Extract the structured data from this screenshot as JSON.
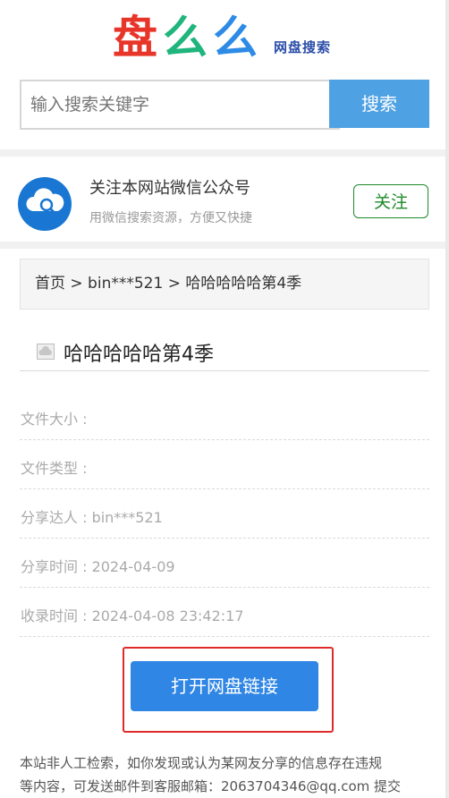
{
  "logo": {
    "char1": "盘",
    "char2": "么",
    "char3": "么",
    "subtitle": "网盘搜索"
  },
  "search": {
    "placeholder": "输入搜索关键字",
    "button_label": "搜索"
  },
  "follow": {
    "title": "关注本网站微信公众号",
    "subtitle": "用微信搜索资源，方便又快捷",
    "button_label": "关注"
  },
  "breadcrumb": {
    "text": "首页 > bin***521 > 哈哈哈哈哈第4季"
  },
  "file": {
    "title": "哈哈哈哈哈第4季",
    "size_label": "文件大小 :",
    "type_label": "文件类型 :",
    "sharer_label": "分享达人 : bin***521",
    "share_time_label": "分享时间 : 2024-04-09",
    "record_time_label": "收录时间 : 2024-04-08 23:42:17"
  },
  "open_button_label": "打开网盘链接",
  "notice": {
    "line1": "本站非人工检索，如你发现或认为某网友分享的信息存在违规",
    "line2": "等内容，可发送邮件到客服邮箱：2063704346@qq.com 提交"
  }
}
